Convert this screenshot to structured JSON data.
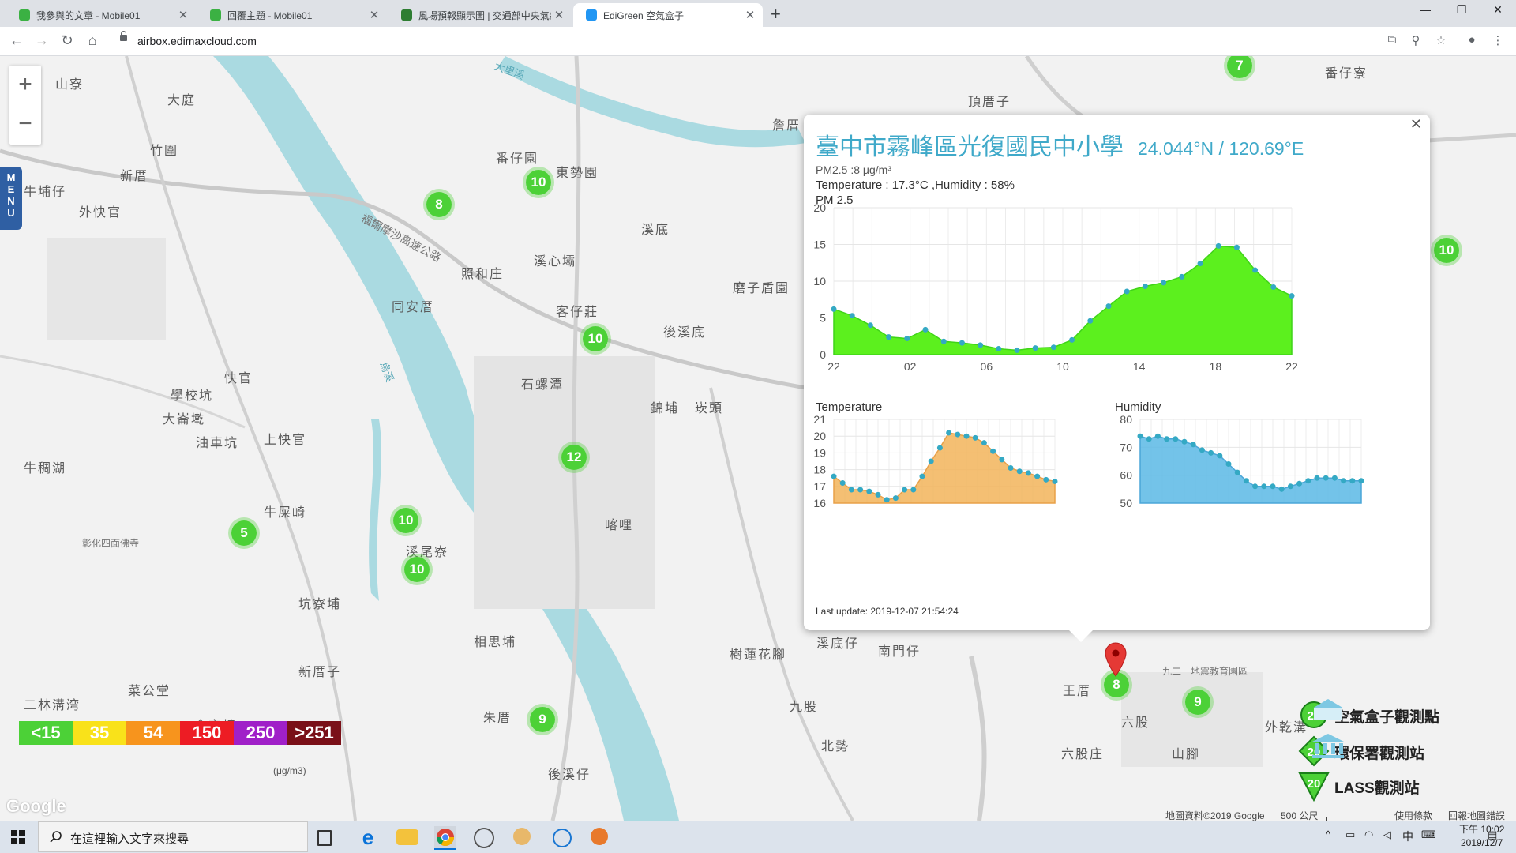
{
  "browser": {
    "tabs": [
      {
        "title": "我參與的文章 - Mobile01",
        "favicon_color": "#3bb143",
        "active": false
      },
      {
        "title": "回覆主題 - Mobile01",
        "favicon_color": "#3bb143",
        "active": false
      },
      {
        "title": "風場預報顯示圖 | 交通部中央氣象局",
        "favicon_color": "#2e7d32",
        "active": false
      },
      {
        "title": "EdiGreen 空氣盒子",
        "favicon_color": "#2196f3",
        "active": true
      }
    ],
    "url": "airbox.edimaxcloud.com"
  },
  "map": {
    "menu_label": [
      "M",
      "E",
      "N",
      "U"
    ],
    "place_labels": [
      {
        "text": "山寮"
      },
      {
        "text": "大庭"
      },
      {
        "text": "竹圍"
      },
      {
        "text": "新厝"
      },
      {
        "text": "牛埔仔"
      },
      {
        "text": "外快官"
      },
      {
        "text": "番仔園"
      },
      {
        "text": "東勢園"
      },
      {
        "text": "溪底"
      },
      {
        "text": "照和庄"
      },
      {
        "text": "溪心壩"
      },
      {
        "text": "同安厝"
      },
      {
        "text": "客仔莊"
      },
      {
        "text": "磨子盾園"
      },
      {
        "text": "後溪底"
      },
      {
        "text": "快官"
      },
      {
        "text": "學校坑"
      },
      {
        "text": "大崙墘"
      },
      {
        "text": "油車坑"
      },
      {
        "text": "上快官"
      },
      {
        "text": "石螺潭"
      },
      {
        "text": "錦埔"
      },
      {
        "text": "崁頭"
      },
      {
        "text": "牛稠湖"
      },
      {
        "text": "牛屎崎"
      },
      {
        "text": "溪尾寮"
      },
      {
        "text": "喀哩"
      },
      {
        "text": "坑寮埔"
      },
      {
        "text": "相思埔"
      },
      {
        "text": "新厝子"
      },
      {
        "text": "菜公堂"
      },
      {
        "text": "二林溝湾"
      },
      {
        "text": "金交椅"
      },
      {
        "text": "朱厝"
      },
      {
        "text": "後溪仔"
      },
      {
        "text": "樹蓮花腳"
      },
      {
        "text": "溪底仔"
      },
      {
        "text": "南門仔"
      },
      {
        "text": "九股"
      },
      {
        "text": "北勢"
      },
      {
        "text": "六股庄"
      },
      {
        "text": "頂厝子"
      },
      {
        "text": "番仔寮"
      },
      {
        "text": "詹厝"
      },
      {
        "text": "王厝"
      },
      {
        "text": "六股"
      },
      {
        "text": "山腳"
      },
      {
        "text": "外乾溝"
      },
      {
        "text": "九二一地震教育園區"
      },
      {
        "text": "福爾摩沙高速公路"
      },
      {
        "text": "大里溪"
      },
      {
        "text": "烏溪"
      },
      {
        "text": "彰化四面佛寺"
      }
    ],
    "clusters": [
      "7",
      "10",
      "10",
      "8",
      "10",
      "12",
      "10",
      "10",
      "5",
      "9",
      "9",
      "8",
      "10"
    ],
    "aqi_scale": {
      "unit": "(μg/m3)",
      "items": [
        {
          "label": "<15",
          "color": "#4cd137"
        },
        {
          "label": "35",
          "color": "#f9e21a"
        },
        {
          "label": "54",
          "color": "#f7941d"
        },
        {
          "label": "150",
          "color": "#ed1c24"
        },
        {
          "label": "250",
          "color": "#a020c8"
        },
        {
          "label": ">251",
          "color": "#7a1018"
        }
      ]
    },
    "legend": [
      {
        "value": "20",
        "label": "空氣盒子觀測點"
      },
      {
        "value": "20",
        "label": "環保署觀測站"
      },
      {
        "value": "20",
        "label": "LASS觀測站"
      }
    ],
    "attribution": {
      "data": "地圖資料©2019 Google",
      "scale": "500 公尺",
      "terms": "使用條款",
      "report": "回報地圖錯誤"
    },
    "google_logo": "Google"
  },
  "popup": {
    "title": "臺中市霧峰區光復國民中小學",
    "coords": "24.044°N / 120.69°E",
    "pm_line": "PM2.5 :8 μg/m³",
    "th_line": "Temperature : 17.3°C ,Humidity : 58%",
    "pm_label": "PM 2.5",
    "temp_label": "Temperature",
    "hum_label": "Humidity",
    "last_update": "Last update: 2019-12-07 21:54:24"
  },
  "chart_data": [
    {
      "type": "area",
      "title": "PM 2.5",
      "x_tick_labels": [
        "22",
        "02",
        "06",
        "10",
        "14",
        "18",
        "22"
      ],
      "ylim": [
        0,
        20
      ],
      "y_ticks": [
        0,
        5,
        10,
        15,
        20
      ],
      "color": "#5cf01e",
      "series": [
        {
          "values": [
            6.2,
            5.3,
            4.0,
            2.4,
            2.2,
            3.4,
            1.8,
            1.6,
            1.3,
            0.8,
            0.6,
            0.9,
            1.0,
            2.0,
            4.6,
            6.6,
            8.6,
            9.3,
            9.8,
            10.6,
            12.4,
            14.8,
            14.6,
            11.5,
            9.2,
            8.0
          ]
        }
      ]
    },
    {
      "type": "area",
      "title": "Temperature",
      "ylim": [
        16,
        21
      ],
      "y_ticks": [
        16,
        17,
        18,
        19,
        20,
        21
      ],
      "color": "#f2b45a",
      "series": [
        {
          "values": [
            17.6,
            17.2,
            16.8,
            16.8,
            16.7,
            16.5,
            16.2,
            16.3,
            16.8,
            16.8,
            17.6,
            18.5,
            19.3,
            20.2,
            20.1,
            20.0,
            19.9,
            19.6,
            19.1,
            18.6,
            18.1,
            17.9,
            17.8,
            17.6,
            17.4,
            17.3
          ]
        }
      ]
    },
    {
      "type": "area",
      "title": "Humidity",
      "ylim": [
        50,
        80
      ],
      "y_ticks": [
        50,
        60,
        70,
        80
      ],
      "color": "#5bb8e5",
      "series": [
        {
          "values": [
            74,
            73,
            74,
            73,
            73,
            72,
            71,
            69,
            68,
            67,
            64,
            61,
            58,
            56,
            56,
            56,
            55,
            56,
            57,
            58,
            59,
            59,
            59,
            58,
            58,
            58
          ]
        }
      ]
    }
  ],
  "taskbar": {
    "search_placeholder": "在這裡輸入文字來搜尋",
    "time": "下午 10:02",
    "date": "2019/12/7",
    "ime": "中"
  }
}
